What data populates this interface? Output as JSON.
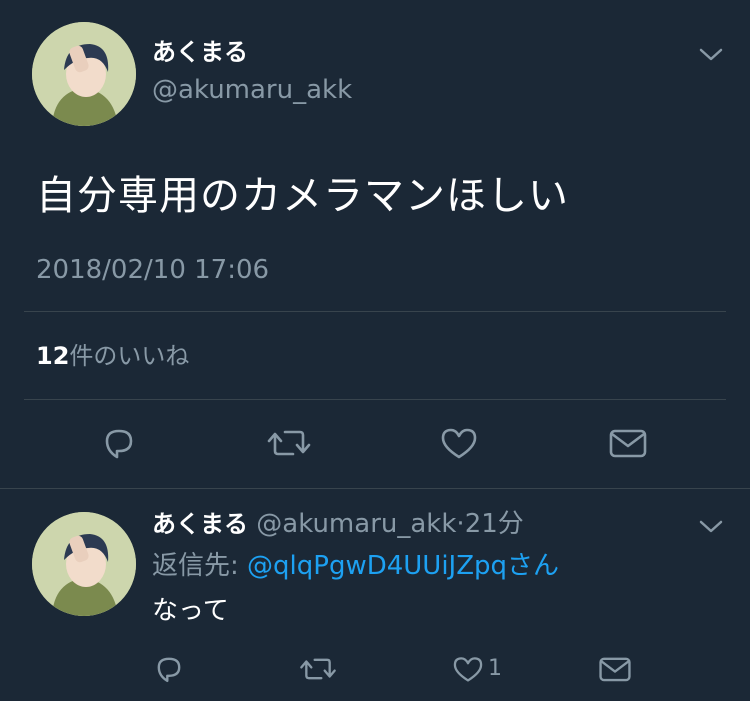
{
  "main_tweet": {
    "display_name": "あくまる",
    "handle": "@akumaru_akk",
    "text": "自分専用のカメラマンほしい",
    "timestamp": "2018/02/10 17:06",
    "likes_count": "12",
    "likes_label": "件のいいね",
    "menu_icon": "chevron-down-icon",
    "actions": [
      "reply-icon",
      "retweet-icon",
      "like-icon",
      "dm-icon"
    ]
  },
  "reply_tweet": {
    "display_name": "あくまる",
    "handle": "@akumaru_akk",
    "separator": "·",
    "time_ago": "21分",
    "reply_to_label": "返信先: ",
    "reply_to_mention": "@qlqPgwD4UUiJZpq",
    "reply_to_suffix": "さん",
    "text": "なって",
    "like_count": "1",
    "menu_icon": "chevron-down-icon",
    "actions": [
      "reply-icon",
      "retweet-icon",
      "like-icon",
      "dm-icon"
    ]
  },
  "colors": {
    "background": "#1b2836",
    "primary_text": "#ffffff",
    "secondary_text": "#8899a6",
    "link": "#1da1f2",
    "divider": "#38444d"
  }
}
